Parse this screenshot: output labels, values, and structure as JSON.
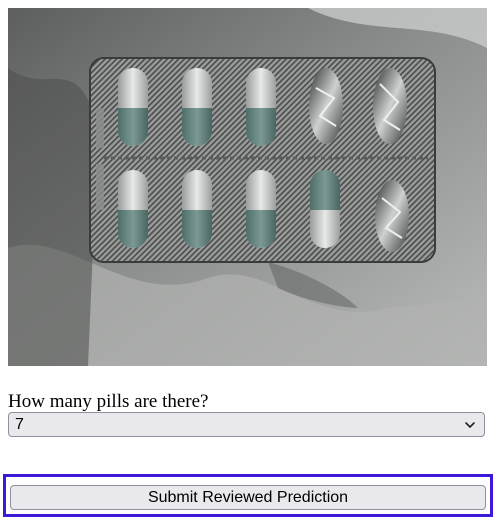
{
  "photo": {
    "subject": "blister-pack-photo",
    "alt": ""
  },
  "form": {
    "question": "How many pills are there?",
    "selected_count": "7",
    "submit_label": "Submit Reviewed Prediction"
  },
  "colors": {
    "focus_outline": "#3d18d9",
    "control_bg": "#e9e9ed",
    "control_border": "#8f8f9d"
  }
}
